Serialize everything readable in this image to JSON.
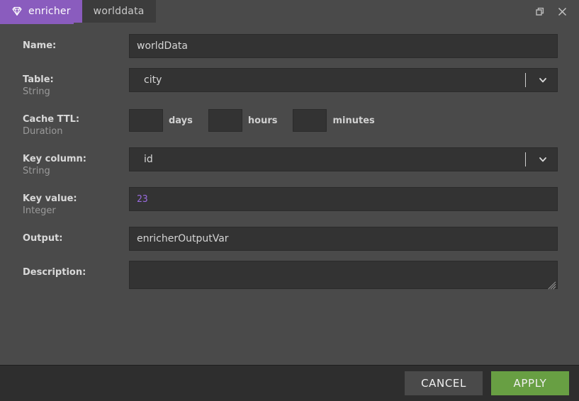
{
  "titlebar": {
    "tabs": [
      {
        "label": "enricher",
        "icon": "gem-icon",
        "active": true
      },
      {
        "label": "worlddata",
        "icon": "",
        "active": false
      }
    ],
    "controls": [
      {
        "name": "restore-window-button",
        "icon": "restore-icon"
      },
      {
        "name": "close-window-button",
        "icon": "close-icon"
      }
    ]
  },
  "form": {
    "name": {
      "label": "Name:",
      "type": "",
      "value": "worldData",
      "placeholder": ""
    },
    "table": {
      "label": "Table:",
      "type": "String",
      "value": "city"
    },
    "cache_ttl": {
      "label": "Cache TTL:",
      "type": "Duration",
      "days": {
        "value": "",
        "unit": "days"
      },
      "hours": {
        "value": "",
        "unit": "hours"
      },
      "minutes": {
        "value": "",
        "unit": "minutes"
      }
    },
    "key_column": {
      "label": "Key column:",
      "type": "String",
      "value": "id"
    },
    "key_value": {
      "label": "Key value:",
      "type": "Integer",
      "value": "23"
    },
    "output": {
      "label": "Output:",
      "type": "",
      "value": "enricherOutputVar",
      "placeholder": ""
    },
    "description": {
      "label": "Description:",
      "type": "",
      "value": "",
      "placeholder": ""
    }
  },
  "footer": {
    "cancel_label": "CANCEL",
    "apply_label": "APPLY"
  },
  "colors": {
    "accent_purple": "#8a5cbe",
    "apply_green": "#689f43",
    "window_bg": "#4a4a4a",
    "input_bg": "#333333",
    "footer_bg": "#2e2e2e",
    "number_literal": "#9a6be0"
  }
}
